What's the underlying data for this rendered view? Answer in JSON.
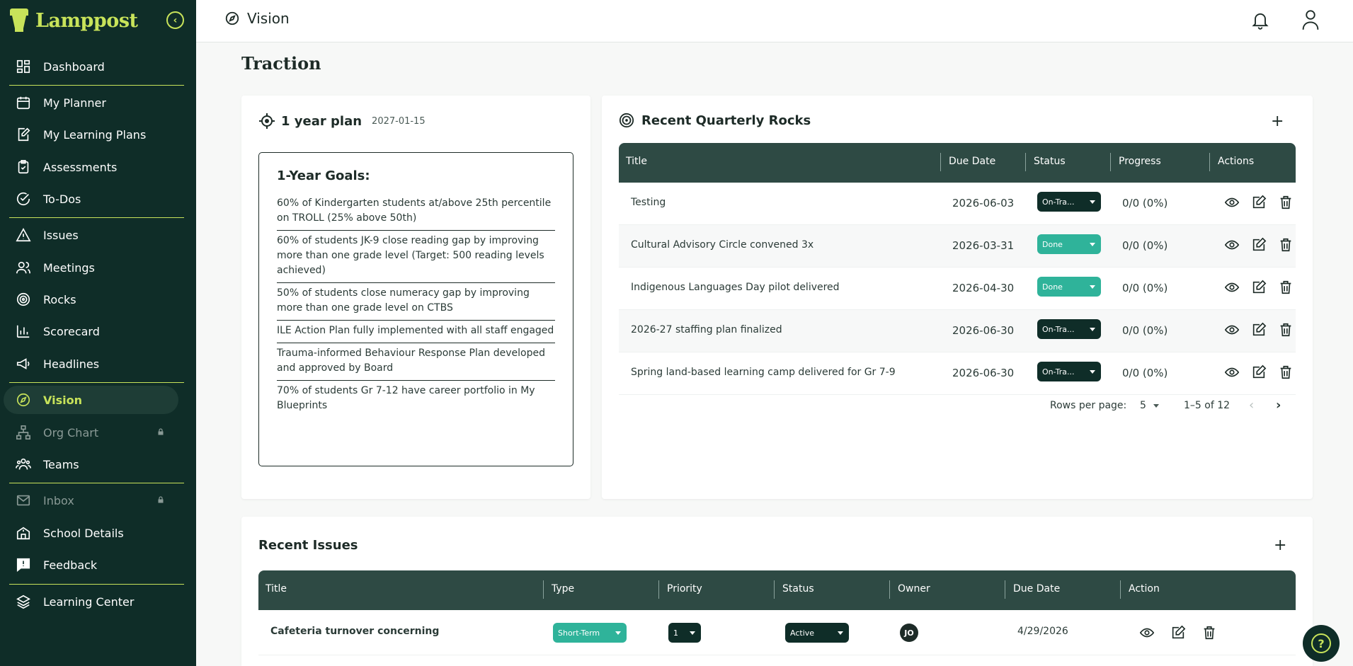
{
  "app": {
    "name": "Lamppost"
  },
  "sidebar": {
    "items": [
      {
        "label": "Dashboard",
        "icon": "grid-icon"
      },
      {
        "label": "My Planner",
        "icon": "calendar-icon"
      },
      {
        "label": "My Learning Plans",
        "icon": "edit-doc-icon"
      },
      {
        "label": "Assessments",
        "icon": "clipboard-check-icon"
      },
      {
        "label": "To-Dos",
        "icon": "check-circle-icon"
      },
      {
        "label": "Issues",
        "icon": "warning-icon"
      },
      {
        "label": "Meetings",
        "icon": "people-icon"
      },
      {
        "label": "Rocks",
        "icon": "target-icon"
      },
      {
        "label": "Scorecard",
        "icon": "bar-chart-icon"
      },
      {
        "label": "Headlines",
        "icon": "megaphone-icon"
      },
      {
        "label": "Vision",
        "icon": "compass-icon",
        "active": true
      },
      {
        "label": "Org Chart",
        "icon": "org-chart-icon",
        "locked": true
      },
      {
        "label": "Teams",
        "icon": "team-icon"
      },
      {
        "label": "Inbox",
        "icon": "mail-icon",
        "locked": true
      },
      {
        "label": "School Details",
        "icon": "school-icon"
      },
      {
        "label": "Feedback",
        "icon": "feedback-icon"
      },
      {
        "label": "Learning Center",
        "icon": "layers-icon"
      }
    ]
  },
  "topbar": {
    "title": "Vision"
  },
  "page": {
    "heading": "Traction"
  },
  "plan": {
    "title": "1 year plan",
    "date": "2027-01-15",
    "goals_heading": "1-Year Goals:",
    "goals": [
      "60% of Kindergarten students at/above 25th percentile on TROLL (25% above 50th)",
      "60% of students JK-9 close reading gap by improving more than one grade level (Target: 500 reading levels achieved)",
      "50% of students close numeracy gap by improving more than one grade level on CTBS",
      "ILE Action Plan fully implemented with all staff engaged",
      "Trauma-informed Behaviour Response Plan developed and approved by Board",
      "70% of students Gr 7-12 have career portfolio in My Blueprints"
    ]
  },
  "rocks": {
    "title": "Recent Quarterly Rocks",
    "add": "+",
    "columns": [
      "Title",
      "Due Date",
      "Status",
      "Progress",
      "Actions"
    ],
    "rows": [
      {
        "title": "Testing",
        "due": "2026-06-03",
        "status": "On-Tra...",
        "progress": "0/0 (0%)"
      },
      {
        "title": "Cultural Advisory Circle convened 3x",
        "due": "2026-03-31",
        "status": "Done",
        "progress": "0/0 (0%)"
      },
      {
        "title": "Indigenous Languages Day pilot delivered",
        "due": "2026-04-30",
        "status": "Done",
        "progress": "0/0 (0%)"
      },
      {
        "title": "2026-27 staffing plan finalized",
        "due": "2026-06-30",
        "status": "On-Tra...",
        "progress": "0/0 (0%)"
      },
      {
        "title": "Spring land-based learning camp delivered for Gr 7-9",
        "due": "2026-06-30",
        "status": "On-Tra...",
        "progress": "0/0 (0%)"
      }
    ],
    "pager": {
      "rows_label": "Rows per page:",
      "rows_value": "5",
      "range": "1–5 of 12"
    }
  },
  "issues": {
    "title": "Recent Issues",
    "add": "+",
    "columns": [
      "Title",
      "Type",
      "Priority",
      "Status",
      "Owner",
      "Due Date",
      "Action"
    ],
    "rows": [
      {
        "title": "Cafeteria turnover concerning",
        "type": "Short-Term",
        "priority": "1",
        "status": "Active",
        "owner": "JO",
        "due": "4/29/2026"
      }
    ]
  },
  "colors": {
    "sidebar": "#0f2d28",
    "accent": "#c8e35a",
    "table_header": "#2e4a44",
    "done": "#2fb39a"
  }
}
